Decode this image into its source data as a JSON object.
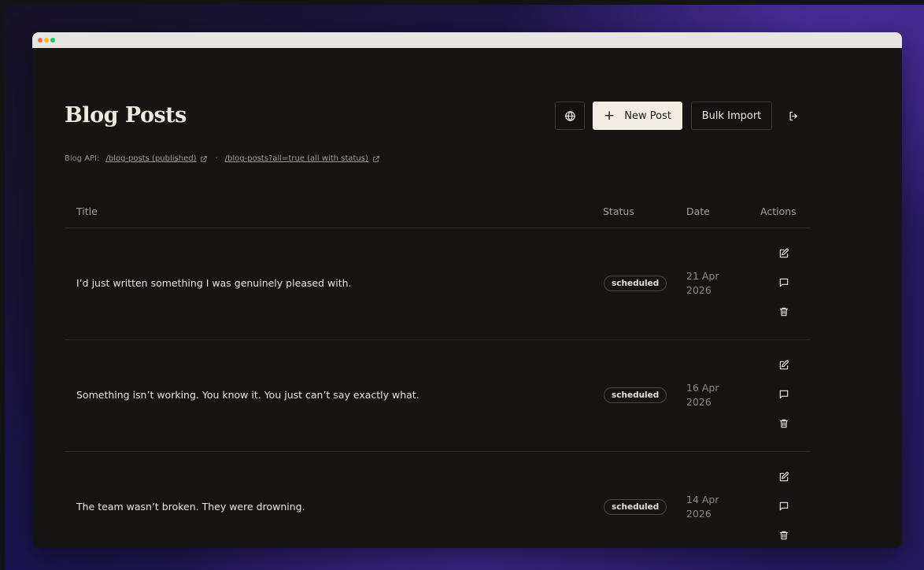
{
  "page": {
    "title": "Blog Posts"
  },
  "toolbar": {
    "new_post_plus": "+",
    "new_post_label": "New Post",
    "bulk_import_label": "Bulk Import"
  },
  "api": {
    "label": "Blog API:",
    "link_published": "/blog-posts (published)",
    "separator": "·",
    "link_all": "/blog-posts?all=true (all with status)"
  },
  "table": {
    "headers": {
      "title": "Title",
      "status": "Status",
      "date": "Date",
      "actions": "Actions"
    },
    "rows": [
      {
        "title": "I’d just written something I was genuinely pleased with.",
        "status": "scheduled",
        "date": "21 Apr 2026"
      },
      {
        "title": "Something isn’t working. You know it. You just can’t say exactly what.",
        "status": "scheduled",
        "date": "16 Apr 2026"
      },
      {
        "title": "The team wasn’t broken. They were drowning.",
        "status": "scheduled",
        "date": "14 Apr 2026"
      }
    ]
  },
  "icons": {
    "toolbar": [
      "globe-icon",
      "plus-icon",
      "logout-icon"
    ],
    "links": [
      "external-link-icon"
    ],
    "row_actions": [
      "edit-icon",
      "comment-icon",
      "trash-icon"
    ]
  },
  "colors": {
    "background": "#161513",
    "primary_button": "#f1ede4",
    "text": "#ebe6dd",
    "muted_text": "#8d877e",
    "border": "#2d2b28"
  }
}
